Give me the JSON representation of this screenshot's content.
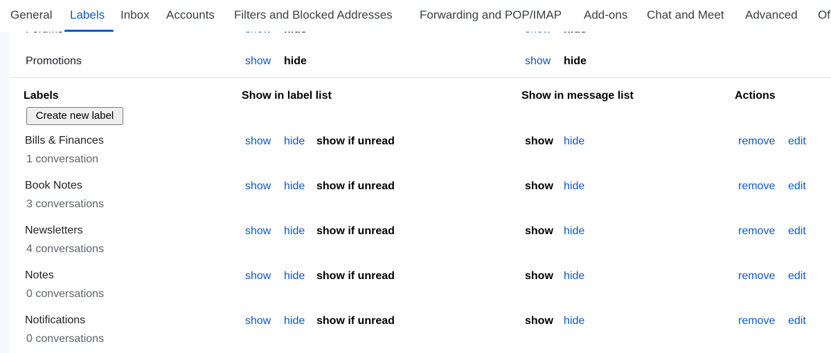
{
  "tabs": [
    {
      "label": "General",
      "active": false
    },
    {
      "label": "Labels",
      "active": true
    },
    {
      "label": "Inbox",
      "active": false
    },
    {
      "label": "Accounts",
      "active": false
    },
    {
      "label": "Filters and Blocked Addresses",
      "active": false
    },
    {
      "label": "Forwarding and POP/IMAP",
      "active": false
    },
    {
      "label": "Add-ons",
      "active": false
    },
    {
      "label": "Chat and Meet",
      "active": false
    },
    {
      "label": "Advanced",
      "active": false
    },
    {
      "label": "Of",
      "active": false
    }
  ],
  "categories": [
    {
      "name": "Forums",
      "show": "show",
      "hide": "hide",
      "msg_show": "show",
      "msg_hide": "hide"
    },
    {
      "name": "Promotions",
      "show": "show",
      "hide": "hide",
      "msg_show": "show",
      "msg_hide": "hide"
    }
  ],
  "labels_header": {
    "labels": "Labels",
    "label_list": "Show in label list",
    "message_list": "Show in message list",
    "actions": "Actions"
  },
  "create_label": "Create new label",
  "labels": [
    {
      "name": "Bills & Finances",
      "count": "1 conversation"
    },
    {
      "name": "Book Notes",
      "count": "3 conversations"
    },
    {
      "name": "Newsletters",
      "count": "4 conversations"
    },
    {
      "name": "Notes",
      "count": "0 conversations"
    },
    {
      "name": "Notifications",
      "count": "0 conversations"
    }
  ],
  "row_actions": {
    "show": "show",
    "hide": "hide",
    "show_if_unread": "show if unread",
    "remove": "remove",
    "edit": "edit"
  },
  "colors": {
    "accent": "#0b57d0"
  }
}
